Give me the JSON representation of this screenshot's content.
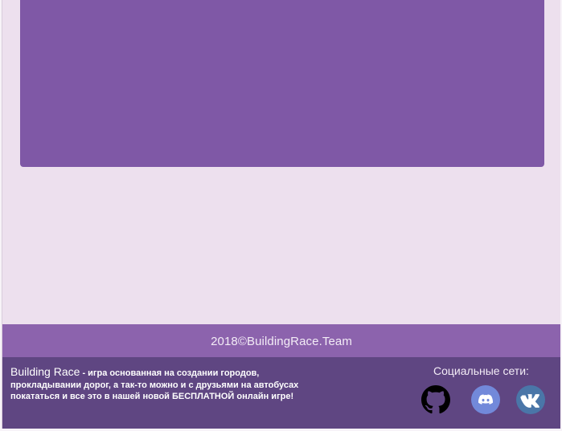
{
  "footer": {
    "copyright": "2018©BuildingRace.Team",
    "about": {
      "brand": "Building Race",
      "separator": " - ",
      "description": "игра основанная на создании городов, прокладывании дорог, а так-то можно и с друзьями на автобусах покататься и все это в нашей новой БЕСПЛАТНОЙ онлайн игре!"
    },
    "social": {
      "title": "Социальные сети:",
      "links": [
        {
          "name": "GitHub",
          "icon": "github-icon",
          "color": "#000000"
        },
        {
          "name": "Discord",
          "icon": "discord-icon",
          "color": "#7289da"
        },
        {
          "name": "VK",
          "icon": "vk-icon",
          "color": "#4a76a8"
        }
      ]
    }
  },
  "colors": {
    "page_background": "#ede0ee",
    "content_card": "#7f58a6",
    "footer_top": "#8c63ad",
    "footer_bottom": "#5f4682"
  }
}
